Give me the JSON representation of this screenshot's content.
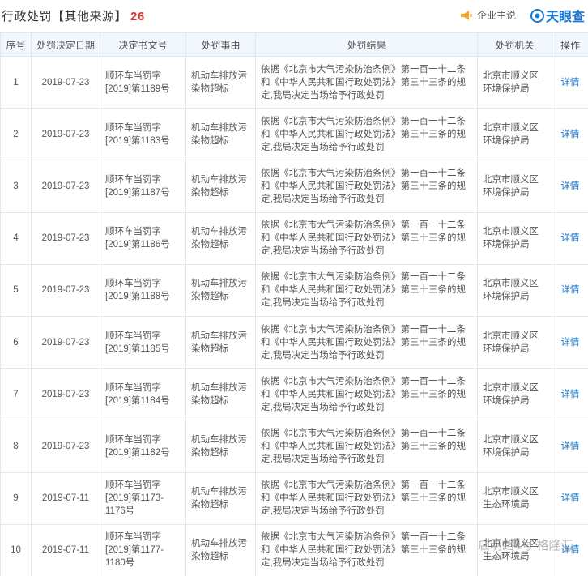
{
  "header": {
    "title": "行政处罚【其他来源】",
    "count": "26",
    "notice_label": "企业主说",
    "logo_text": "天眼查"
  },
  "table": {
    "columns": [
      "序号",
      "处罚决定日期",
      "决定书文号",
      "处罚事由",
      "处罚结果",
      "处罚机关",
      "操作"
    ],
    "rows": [
      {
        "idx": "1",
        "date": "2019-07-23",
        "doc": "顺环车当罚字[2019]第1189号",
        "reason": "机动车排放污染物超标",
        "result": "依据《北京市大气污染防治条例》第一百一十二条和《中华人民共和国行政处罚法》第三十三条的规定,我局决定当场给予行政处罚",
        "org": "北京市顺义区环境保护局",
        "action": "详情"
      },
      {
        "idx": "2",
        "date": "2019-07-23",
        "doc": "顺环车当罚字[2019]第1183号",
        "reason": "机动车排放污染物超标",
        "result": "依据《北京市大气污染防治条例》第一百一十二条和《中华人民共和国行政处罚法》第三十三条的规定,我局决定当场给予行政处罚",
        "org": "北京市顺义区环境保护局",
        "action": "详情"
      },
      {
        "idx": "3",
        "date": "2019-07-23",
        "doc": "顺环车当罚字[2019]第1187号",
        "reason": "机动车排放污染物超标",
        "result": "依据《北京市大气污染防治条例》第一百一十二条和《中华人民共和国行政处罚法》第三十三条的规定,我局决定当场给予行政处罚",
        "org": "北京市顺义区环境保护局",
        "action": "详情"
      },
      {
        "idx": "4",
        "date": "2019-07-23",
        "doc": "顺环车当罚字[2019]第1186号",
        "reason": "机动车排放污染物超标",
        "result": "依据《北京市大气污染防治条例》第一百一十二条和《中华人民共和国行政处罚法》第三十三条的规定,我局决定当场给予行政处罚",
        "org": "北京市顺义区环境保护局",
        "action": "详情"
      },
      {
        "idx": "5",
        "date": "2019-07-23",
        "doc": "顺环车当罚字[2019]第1188号",
        "reason": "机动车排放污染物超标",
        "result": "依据《北京市大气污染防治条例》第一百一十二条和《中华人民共和国行政处罚法》第三十三条的规定,我局决定当场给予行政处罚",
        "org": "北京市顺义区环境保护局",
        "action": "详情"
      },
      {
        "idx": "6",
        "date": "2019-07-23",
        "doc": "顺环车当罚字[2019]第1185号",
        "reason": "机动车排放污染物超标",
        "result": "依据《北京市大气污染防治条例》第一百一十二条和《中华人民共和国行政处罚法》第三十三条的规定,我局决定当场给予行政处罚",
        "org": "北京市顺义区环境保护局",
        "action": "详情"
      },
      {
        "idx": "7",
        "date": "2019-07-23",
        "doc": "顺环车当罚字[2019]第1184号",
        "reason": "机动车排放污染物超标",
        "result": "依据《北京市大气污染防治条例》第一百一十二条和《中华人民共和国行政处罚法》第三十三条的规定,我局决定当场给予行政处罚",
        "org": "北京市顺义区环境保护局",
        "action": "详情"
      },
      {
        "idx": "8",
        "date": "2019-07-23",
        "doc": "顺环车当罚字[2019]第1182号",
        "reason": "机动车排放污染物超标",
        "result": "依据《北京市大气污染防治条例》第一百一十二条和《中华人民共和国行政处罚法》第三十三条的规定,我局决定当场给予行政处罚",
        "org": "北京市顺义区环境保护局",
        "action": "详情"
      },
      {
        "idx": "9",
        "date": "2019-07-11",
        "doc": "顺环车当罚字[2019]第1173-1176号",
        "reason": "机动车排放污染物超标",
        "result": "依据《北京市大气污染防治条例》第一百一十二条和《中华人民共和国行政处罚法》第三十三条的规定,我局决定当场给予行政处罚",
        "org": "北京市顺义区生态环境局",
        "action": "详情"
      },
      {
        "idx": "10",
        "date": "2019-07-11",
        "doc": "顺环车当罚字[2019]第1177-1180号",
        "reason": "机动车排放污染物超标",
        "result": "依据《北京市大气污染防治条例》第一百一十二条和《中华人民共和国行政处罚法》第三十三条的规定,我局决定当场给予行政处罚",
        "org": "北京市顺义区生态环境局",
        "action": "详情"
      }
    ]
  },
  "watermark": "启明路4号 格隆汇",
  "colors": {
    "accent": "#1677d2",
    "count_red": "#e0312e",
    "header_bg": "#f2f8fd",
    "border": "#e3e8ee"
  }
}
